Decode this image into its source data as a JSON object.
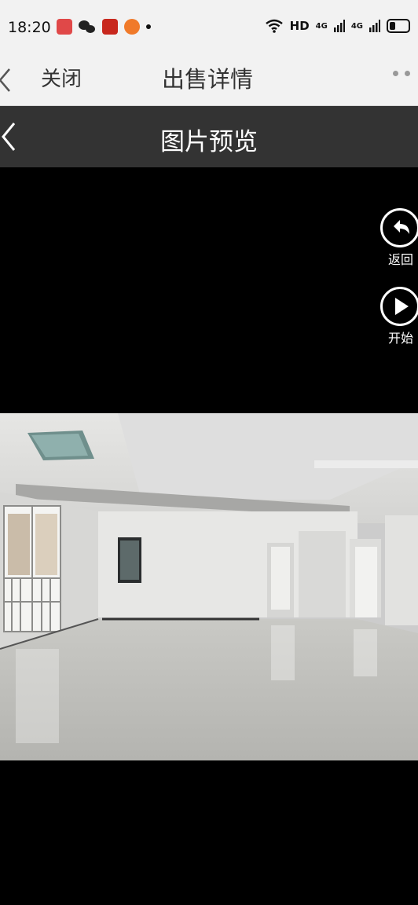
{
  "status": {
    "time": "18:20",
    "network_label": "HD",
    "signal1": "4G",
    "signal2": "4G"
  },
  "header": {
    "close_label": "关闭",
    "title": "出售详情"
  },
  "preview": {
    "title": "图片预览"
  },
  "controls": {
    "back_label": "返回",
    "start_label": "开始"
  },
  "icons": {
    "close": "chevron-left-icon",
    "back": "undo-arrow-icon",
    "play": "play-icon",
    "more": "ellipsis-icon"
  }
}
